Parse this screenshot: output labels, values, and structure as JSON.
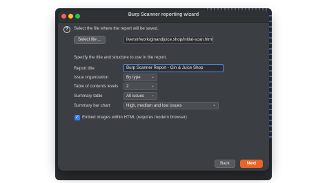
{
  "window": {
    "title": "Burp Scanner reporting wizard"
  },
  "intro": {
    "instruction": "Select the file where the report will be saved.",
    "select_file_label": "Select file ...",
    "file_path": "ilverstr/work/ginandjuice.shop/initial-scan.html"
  },
  "settings": {
    "instruction": "Specify the title and structure to use in the report.",
    "report_title_label": "Report title",
    "report_title_value": "Burp Scanner Report - Gin & Juice Shop",
    "issue_org_label": "Issue organization",
    "issue_org_value": "By type",
    "toc_label": "Table of contents levels",
    "toc_value": "2",
    "summary_table_label": "Summary table",
    "summary_table_value": "All issues",
    "summary_chart_label": "Summary bar chart",
    "summary_chart_value": "High, medium and low issues",
    "embed_images_label": "Embed images within HTML (requires modern browser)",
    "embed_images_checked": true
  },
  "footer": {
    "back_label": "Back",
    "next_label": "Next"
  },
  "colors": {
    "accent": "#e8652a",
    "focus": "#5a8ee6"
  }
}
